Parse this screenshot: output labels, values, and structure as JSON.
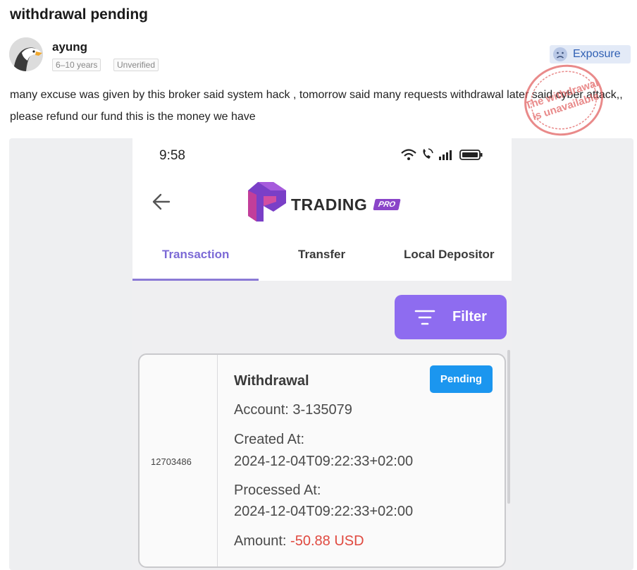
{
  "post": {
    "title": "withdrawal pending",
    "author": {
      "username": "ayung",
      "tag_years": "6–10 years",
      "tag_status": "Unverified"
    },
    "exposure_label": "Exposure",
    "body": "many excuse was given by this broker said system hack , tomorrow said many requests withdrawal later said cyber attack,, please refund our fund this is the money we have",
    "stamp_text": {
      "line1": "The withdrawal",
      "line2": "is unavailable"
    }
  },
  "phone": {
    "status_bar": {
      "time": "9:58"
    },
    "app": {
      "brand": "TRADING",
      "brand_badge": "PRO"
    },
    "tabs": [
      {
        "label": "Transaction",
        "active": true
      },
      {
        "label": "Transfer",
        "active": false
      },
      {
        "label": "Local Depositor",
        "active": false
      }
    ],
    "filter_label": "Filter",
    "transaction": {
      "id": "12703486",
      "type": "Withdrawal",
      "status": "Pending",
      "account": "Account: 3-135079",
      "created_label": "Created At:",
      "created_value": "2024-12-04T09:22:33+02:00",
      "processed_label": "Processed At:",
      "processed_value": "2024-12-04T09:22:33+02:00",
      "amount_label": "Amount: ",
      "amount_value": "-50.88 USD"
    }
  },
  "colors": {
    "accent_purple": "#8e6cf0",
    "tab_active": "#7c6ad6",
    "pending_blue": "#1b96ef",
    "amount_red": "#e0493f",
    "stamp_red": "#e05a5a",
    "exposure_blue": "#2f5fb3"
  },
  "icons": [
    "eagle-avatar",
    "sad-face-icon",
    "wifi-icon",
    "call-icon",
    "signal-icon",
    "battery-icon",
    "back-arrow-icon",
    "trading-pro-logo",
    "filter-icon"
  ]
}
